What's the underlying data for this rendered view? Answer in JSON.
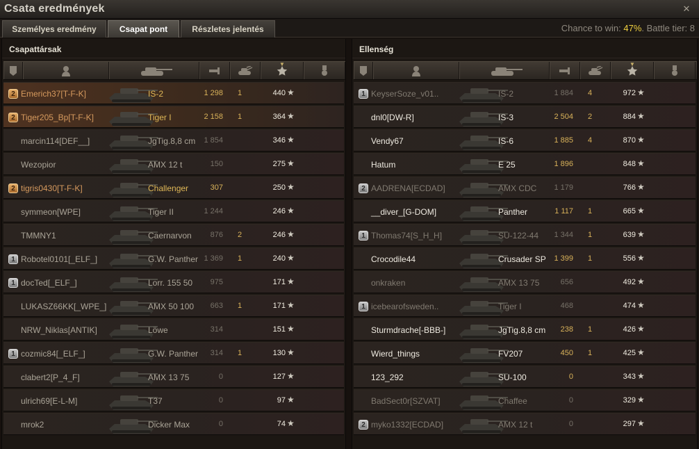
{
  "window": {
    "title": "Csata eredmények"
  },
  "tabs": [
    {
      "label": "Személyes eredmény"
    },
    {
      "label": "Csapat pont"
    },
    {
      "label": "Részletes jelentés"
    }
  ],
  "battle_info": {
    "chance_label": "Chance to win: ",
    "chance_value": "47%",
    "tier_text": ". Battle tier: 8"
  },
  "colors": {
    "accent_gold": "#f0d040",
    "platoon_badge": "#d39048",
    "highlight_row": "#4e3220"
  },
  "left_team": {
    "title": "Csapattársak",
    "rows": [
      {
        "badge": "2",
        "badge_type": "platoon",
        "player": "Emerich37[T-F-K]",
        "tank": "IS-2",
        "damage": "1 298",
        "kills": "1",
        "xp": "440",
        "player_color": "orange",
        "tank_color": "gold",
        "highlight": true
      },
      {
        "badge": "2",
        "badge_type": "platoon",
        "player": "Tiger205_Bp[T-F-K]",
        "tank": "Tiger I",
        "damage": "2 158",
        "kills": "1",
        "xp": "364",
        "player_color": "orange",
        "tank_color": "gold",
        "highlight": true
      },
      {
        "badge": "",
        "badge_type": "",
        "player": "marcin114[DEF__]",
        "tank": "JgTig.8,8 cm",
        "damage": "1 854",
        "kills": "",
        "xp": "346",
        "player_color": "grey",
        "tank_color": "grey"
      },
      {
        "badge": "",
        "badge_type": "",
        "player": "Wezopior",
        "tank": "AMX 12 t",
        "damage": "150",
        "kills": "",
        "xp": "275",
        "player_color": "grey",
        "tank_color": "grey"
      },
      {
        "badge": "2",
        "badge_type": "platoon",
        "player": "tigris0430[T-F-K]",
        "tank": "Challenger",
        "damage": "307",
        "kills": "",
        "xp": "250",
        "player_color": "orange",
        "tank_color": "gold"
      },
      {
        "badge": "",
        "badge_type": "",
        "player": "symmeon[WPE]",
        "tank": "Tiger II",
        "damage": "1 244",
        "kills": "",
        "xp": "246",
        "player_color": "grey",
        "tank_color": "grey"
      },
      {
        "badge": "",
        "badge_type": "",
        "player": "TMMNY1",
        "tank": "Caernarvon",
        "damage": "876",
        "kills": "2",
        "xp": "246",
        "player_color": "grey",
        "tank_color": "grey"
      },
      {
        "badge": "1",
        "badge_type": "clan",
        "player": "Robotel0101[_ELF_]",
        "tank": "G.W. Panther",
        "damage": "1 369",
        "kills": "1",
        "xp": "240",
        "player_color": "grey",
        "tank_color": "grey"
      },
      {
        "badge": "1",
        "badge_type": "clan",
        "player": "docTed[_ELF_]",
        "tank": "Lorr. 155 50",
        "damage": "975",
        "kills": "",
        "xp": "171",
        "player_color": "grey",
        "tank_color": "grey"
      },
      {
        "badge": "",
        "badge_type": "",
        "player": "LUKASZ66KK[_WPE_]",
        "tank": "AMX 50 100",
        "damage": "663",
        "kills": "1",
        "xp": "171",
        "player_color": "grey",
        "tank_color": "grey"
      },
      {
        "badge": "",
        "badge_type": "",
        "player": "NRW_Niklas[ANTIK]",
        "tank": "Löwe",
        "damage": "314",
        "kills": "",
        "xp": "151",
        "player_color": "grey",
        "tank_color": "grey"
      },
      {
        "badge": "1",
        "badge_type": "clan",
        "player": "cozmic84[_ELF_]",
        "tank": "G.W. Panther",
        "damage": "314",
        "kills": "1",
        "xp": "130",
        "player_color": "grey",
        "tank_color": "grey"
      },
      {
        "badge": "",
        "badge_type": "",
        "player": "clabert2[P_4_F]",
        "tank": "AMX 13 75",
        "damage": "0",
        "kills": "",
        "xp": "127",
        "player_color": "grey",
        "tank_color": "grey"
      },
      {
        "badge": "",
        "badge_type": "",
        "player": "ulrich69[E-L-M]",
        "tank": "T37",
        "damage": "0",
        "kills": "",
        "xp": "97",
        "player_color": "grey",
        "tank_color": "grey"
      },
      {
        "badge": "",
        "badge_type": "",
        "player": "mrok2",
        "tank": "Dicker Max",
        "damage": "0",
        "kills": "",
        "xp": "74",
        "player_color": "grey",
        "tank_color": "grey"
      }
    ]
  },
  "right_team": {
    "title": "Ellenség",
    "rows": [
      {
        "badge": "1",
        "badge_type": "clan",
        "player": "KeyserSoze_v01..",
        "tank": "IS-2",
        "damage": "1 884",
        "kills": "4",
        "xp": "972",
        "player_color": "dim",
        "tank_color": "dim"
      },
      {
        "badge": "",
        "badge_type": "",
        "player": "dnl0[DW-R]",
        "tank": "IS-3",
        "damage": "2 504",
        "kills": "2",
        "xp": "884",
        "player_color": "white",
        "tank_color": "white"
      },
      {
        "badge": "",
        "badge_type": "",
        "player": "Vendy67",
        "tank": "IS-6",
        "damage": "1 885",
        "kills": "4",
        "xp": "870",
        "player_color": "white",
        "tank_color": "white"
      },
      {
        "badge": "",
        "badge_type": "",
        "player": "Hatum",
        "tank": "E 25",
        "damage": "1 896",
        "kills": "",
        "xp": "848",
        "player_color": "white",
        "tank_color": "white"
      },
      {
        "badge": "2",
        "badge_type": "clan",
        "player": "AADRENA[ECDAD]",
        "tank": "AMX CDC",
        "damage": "1 179",
        "kills": "",
        "xp": "766",
        "player_color": "dim",
        "tank_color": "dim"
      },
      {
        "badge": "",
        "badge_type": "",
        "player": "__diver_[G-DOM]",
        "tank": "Panther",
        "damage": "1 117",
        "kills": "1",
        "xp": "665",
        "player_color": "white",
        "tank_color": "white"
      },
      {
        "badge": "1",
        "badge_type": "clan",
        "player": "Thomas74[S_H_H]",
        "tank": "SU-122-44",
        "damage": "1 344",
        "kills": "1",
        "xp": "639",
        "player_color": "dim",
        "tank_color": "dim"
      },
      {
        "badge": "",
        "badge_type": "",
        "player": "Crocodile44",
        "tank": "Crusader SP",
        "damage": "1 399",
        "kills": "1",
        "xp": "556",
        "player_color": "white",
        "tank_color": "white"
      },
      {
        "badge": "",
        "badge_type": "",
        "player": "onkraken",
        "tank": "AMX 13 75",
        "damage": "656",
        "kills": "",
        "xp": "492",
        "player_color": "dim",
        "tank_color": "dim"
      },
      {
        "badge": "1",
        "badge_type": "clan",
        "player": "icebearofsweden..",
        "tank": "Tiger I",
        "damage": "468",
        "kills": "",
        "xp": "474",
        "player_color": "dim",
        "tank_color": "dim"
      },
      {
        "badge": "",
        "badge_type": "",
        "player": "Sturmdrache[-BBB-]",
        "tank": "JgTig.8,8 cm",
        "damage": "238",
        "kills": "1",
        "xp": "426",
        "player_color": "white",
        "tank_color": "white"
      },
      {
        "badge": "",
        "badge_type": "",
        "player": "Wierd_things",
        "tank": "FV207",
        "damage": "450",
        "kills": "1",
        "xp": "425",
        "player_color": "white",
        "tank_color": "white"
      },
      {
        "badge": "",
        "badge_type": "",
        "player": "123_292",
        "tank": "SU-100",
        "damage": "0",
        "kills": "",
        "xp": "343",
        "player_color": "white",
        "tank_color": "white"
      },
      {
        "badge": "",
        "badge_type": "",
        "player": "BadSect0r[SZVAT]",
        "tank": "Chaffee",
        "damage": "0",
        "kills": "",
        "xp": "329",
        "player_color": "dim",
        "tank_color": "dim"
      },
      {
        "badge": "2",
        "badge_type": "clan",
        "player": "myko1332[ECDAD]",
        "tank": "AMX 12 t",
        "damage": "0",
        "kills": "",
        "xp": "297",
        "player_color": "dim",
        "tank_color": "dim"
      }
    ]
  },
  "star_glyph": "★",
  "icons": [
    "squad-icon",
    "player-icon",
    "tank-icon",
    "damage-icon",
    "kills-icon",
    "xp-star-icon",
    "medal-icon"
  ]
}
